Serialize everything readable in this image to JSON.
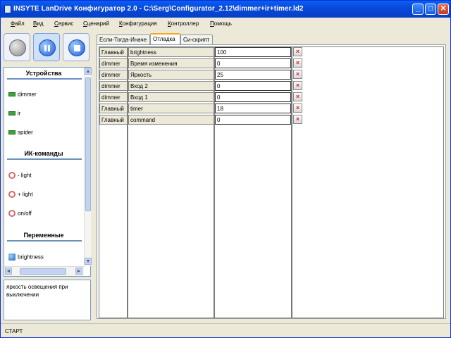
{
  "window": {
    "title": "INSYTE LanDrive Конфигуратор 2.0 - C:\\Serg\\Configurator_2.12\\dimmer+ir+timer.ld2",
    "minimize": "_",
    "maximize": "□",
    "close": "✕"
  },
  "menu": [
    "Файл",
    "Вид",
    "Сервис",
    "Сценарий",
    "Конфигурация",
    "Контроллер",
    "Помощь"
  ],
  "toolbar": {
    "buttons": [
      "record-button",
      "pause-button",
      "stop-button"
    ],
    "active": "pause-button"
  },
  "sidebar": {
    "devices_title": "Устройства",
    "devices": [
      "dimmer",
      "ir",
      "spider"
    ],
    "ir_title": "ИК-команды",
    "ir_commands": [
      "- light",
      "+ light",
      "on/off"
    ],
    "vars_title": "Переменные",
    "variables": [
      "brightness"
    ],
    "scroll_up": "▲",
    "scroll_down": "▼",
    "scroll_left": "◄",
    "scroll_right": "►"
  },
  "description": "яркость освещения при выключении",
  "tabs": [
    "Если-Тогда-Иначе",
    "Отладка",
    "Си-скрипт"
  ],
  "selected_tab": "Отладка",
  "debug_table": {
    "rows": [
      {
        "source": "Главный",
        "name": "brightness",
        "value": "100"
      },
      {
        "source": "dimmer",
        "name": "Время изменения",
        "value": "0"
      },
      {
        "source": "dimmer",
        "name": "Яркость",
        "value": "25"
      },
      {
        "source": "dimmer",
        "name": "Вход 2",
        "value": "0"
      },
      {
        "source": "dimmer",
        "name": "Вход 1",
        "value": "0"
      },
      {
        "source": "Главный",
        "name": "timer",
        "value": "18"
      },
      {
        "source": "Главный",
        "name": "command",
        "value": "0"
      }
    ],
    "delete_glyph": "×"
  },
  "status": "СТАРТ",
  "colors": {
    "titlebar": "#0a5ef5",
    "chrome": "#ece9d8",
    "section_line": "#6f8fbf",
    "delete_icon": "#dd2222"
  }
}
